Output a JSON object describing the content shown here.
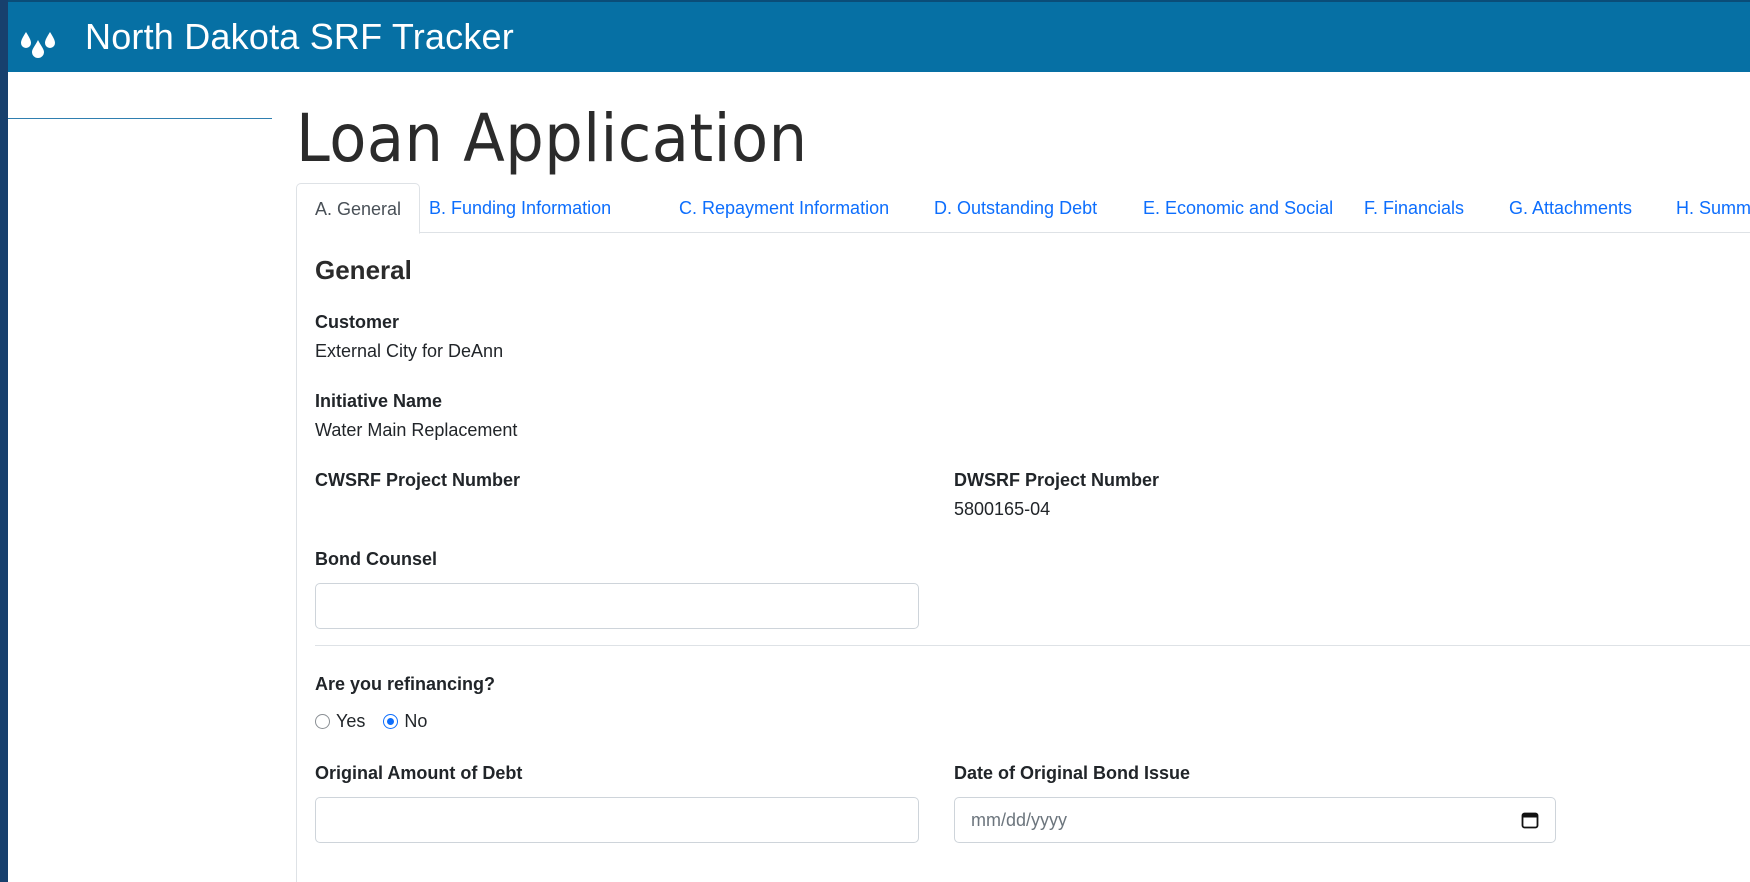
{
  "app": {
    "title": "North Dakota SRF Tracker",
    "icon": "water-drops-icon"
  },
  "page": {
    "title": "Loan Application"
  },
  "tabs": [
    {
      "label": "A. General",
      "active": true
    },
    {
      "label": "B. Funding Information",
      "active": false
    },
    {
      "label": "C. Repayment Information",
      "active": false
    },
    {
      "label": "D. Outstanding Debt",
      "active": false
    },
    {
      "label": "E. Economic and Social",
      "active": false
    },
    {
      "label": "F. Financials",
      "active": false
    },
    {
      "label": "G. Attachments",
      "active": false
    },
    {
      "label": "H. Summa",
      "active": false
    }
  ],
  "general": {
    "section_title": "General",
    "customer_label": "Customer",
    "customer_value": "External City for DeAnn",
    "initiative_label": "Initiative Name",
    "initiative_value": "Water Main Replacement",
    "cwsrf_label": "CWSRF Project Number",
    "cwsrf_value": "",
    "dwsrf_label": "DWSRF Project Number",
    "dwsrf_value": "5800165-04",
    "bond_counsel_label": "Bond Counsel",
    "bond_counsel_value": "",
    "refinancing_label": "Are you refinancing?",
    "refinancing_yes": "Yes",
    "refinancing_no": "No",
    "refinancing_selected": "No",
    "original_amount_label": "Original Amount of Debt",
    "original_amount_value": "",
    "bond_issue_date_label": "Date of Original Bond Issue",
    "bond_issue_date_placeholder": "mm/dd/yyyy"
  },
  "colors": {
    "navbar": "#0670a4",
    "link": "#0d6efd",
    "outer": "#17406d"
  }
}
